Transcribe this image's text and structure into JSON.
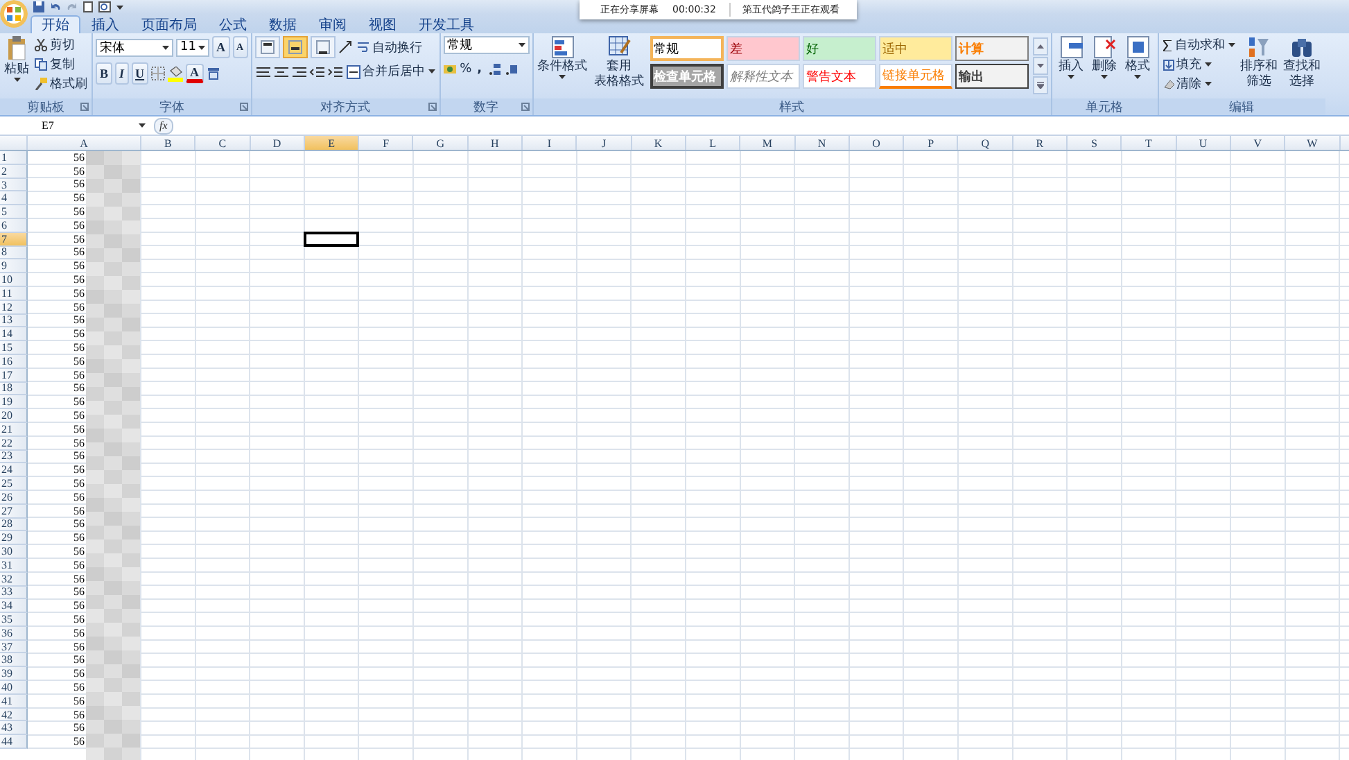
{
  "share_banner": {
    "status": "正在分享屏幕",
    "time": "00:00:32",
    "viewer": "第五代鸽子王正在观看"
  },
  "tabs": [
    {
      "label": "开始",
      "selected": true
    },
    {
      "label": "插入",
      "selected": false
    },
    {
      "label": "页面布局",
      "selected": false
    },
    {
      "label": "公式",
      "selected": false
    },
    {
      "label": "数据",
      "selected": false
    },
    {
      "label": "审阅",
      "selected": false
    },
    {
      "label": "视图",
      "selected": false
    },
    {
      "label": "开发工具",
      "selected": false
    }
  ],
  "ribbon": {
    "clipboard": {
      "label": "剪贴板",
      "paste": "粘贴",
      "items": [
        "剪切",
        "复制",
        "格式刷"
      ]
    },
    "font": {
      "label": "字体",
      "font_name": "宋体",
      "font_size": "11",
      "grow": "A",
      "shrink": "A",
      "bold": "B",
      "italic": "I",
      "underline": "U",
      "font_color": "A"
    },
    "alignment": {
      "label": "对齐方式",
      "vertical": [
        {
          "selected": false
        },
        {
          "selected": true
        },
        {
          "selected": false
        }
      ],
      "wrap": "自动换行",
      "merge": "合并后居中"
    },
    "number": {
      "label": "数字",
      "format": "常规",
      "percent": "%",
      "comma": ","
    },
    "styles": {
      "label": "样式",
      "conditional": "条件格式",
      "table": [
        "套用",
        "表格格式"
      ],
      "cell_styles": [
        {
          "name": "常规",
          "kind": "normal",
          "selected": true
        },
        {
          "name": "差",
          "kind": "bad",
          "selected": false
        },
        {
          "name": "好",
          "kind": "good",
          "selected": false
        },
        {
          "name": "适中",
          "kind": "neutral",
          "selected": false
        },
        {
          "name": "计算",
          "kind": "calc",
          "selected": false
        },
        {
          "name": "检查单元格",
          "kind": "check",
          "selected": false
        },
        {
          "name": "解释性文本",
          "kind": "explanatory",
          "selected": false
        },
        {
          "name": "警告文本",
          "kind": "warning",
          "selected": false
        },
        {
          "name": "链接单元格",
          "kind": "linked",
          "selected": false
        },
        {
          "name": "输出",
          "kind": "output",
          "selected": false
        }
      ]
    },
    "cells": {
      "label": "单元格",
      "buttons": [
        {
          "label": "插入",
          "kind": "insert"
        },
        {
          "label": "删除",
          "kind": "delete"
        },
        {
          "label": "格式",
          "kind": "format"
        }
      ]
    },
    "editing": {
      "label": "编辑",
      "autosum": "自动求和",
      "fill": "填充",
      "clear": "清除",
      "sort": [
        "排序和",
        "筛选"
      ],
      "find": [
        "查找和",
        "选择"
      ]
    }
  },
  "formula_bar": {
    "name_box": "E7",
    "fx": "fx"
  },
  "sheet": {
    "columns": [
      {
        "label": "A",
        "selected": false
      },
      {
        "label": "B",
        "selected": false
      },
      {
        "label": "C",
        "selected": false
      },
      {
        "label": "D",
        "selected": false
      },
      {
        "label": "E",
        "selected": true
      },
      {
        "label": "F",
        "selected": false
      },
      {
        "label": "G",
        "selected": false
      },
      {
        "label": "H",
        "selected": false
      },
      {
        "label": "I",
        "selected": false
      },
      {
        "label": "J",
        "selected": false
      },
      {
        "label": "K",
        "selected": false
      },
      {
        "label": "L",
        "selected": false
      },
      {
        "label": "M",
        "selected": false
      },
      {
        "label": "N",
        "selected": false
      },
      {
        "label": "O",
        "selected": false
      },
      {
        "label": "P",
        "selected": false
      },
      {
        "label": "Q",
        "selected": false
      },
      {
        "label": "R",
        "selected": false
      },
      {
        "label": "S",
        "selected": false
      },
      {
        "label": "T",
        "selected": false
      },
      {
        "label": "U",
        "selected": false
      },
      {
        "label": "V",
        "selected": false
      },
      {
        "label": "W",
        "selected": false
      }
    ],
    "rows": [
      {
        "label": "1",
        "selected": false,
        "a": "56"
      },
      {
        "label": "2",
        "selected": false,
        "a": "56"
      },
      {
        "label": "3",
        "selected": false,
        "a": "56"
      },
      {
        "label": "4",
        "selected": false,
        "a": "56"
      },
      {
        "label": "5",
        "selected": false,
        "a": "56"
      },
      {
        "label": "6",
        "selected": false,
        "a": "56"
      },
      {
        "label": "7",
        "selected": true,
        "a": "56"
      },
      {
        "label": "8",
        "selected": false,
        "a": "56"
      },
      {
        "label": "9",
        "selected": false,
        "a": "56"
      },
      {
        "label": "10",
        "selected": false,
        "a": "56"
      },
      {
        "label": "11",
        "selected": false,
        "a": "56"
      },
      {
        "label": "12",
        "selected": false,
        "a": "56"
      },
      {
        "label": "13",
        "selected": false,
        "a": "56"
      },
      {
        "label": "14",
        "selected": false,
        "a": "56"
      },
      {
        "label": "15",
        "selected": false,
        "a": "56"
      },
      {
        "label": "16",
        "selected": false,
        "a": "56"
      },
      {
        "label": "17",
        "selected": false,
        "a": "56"
      },
      {
        "label": "18",
        "selected": false,
        "a": "56"
      },
      {
        "label": "19",
        "selected": false,
        "a": "56"
      },
      {
        "label": "20",
        "selected": false,
        "a": "56"
      },
      {
        "label": "21",
        "selected": false,
        "a": "56"
      },
      {
        "label": "22",
        "selected": false,
        "a": "56"
      },
      {
        "label": "23",
        "selected": false,
        "a": "56"
      },
      {
        "label": "24",
        "selected": false,
        "a": "56"
      },
      {
        "label": "25",
        "selected": false,
        "a": "56"
      },
      {
        "label": "26",
        "selected": false,
        "a": "56"
      },
      {
        "label": "27",
        "selected": false,
        "a": "56"
      },
      {
        "label": "28",
        "selected": false,
        "a": "56"
      },
      {
        "label": "29",
        "selected": false,
        "a": "56"
      },
      {
        "label": "30",
        "selected": false,
        "a": "56"
      },
      {
        "label": "31",
        "selected": false,
        "a": "56"
      },
      {
        "label": "32",
        "selected": false,
        "a": "56"
      },
      {
        "label": "33",
        "selected": false,
        "a": "56"
      },
      {
        "label": "34",
        "selected": false,
        "a": "56"
      },
      {
        "label": "35",
        "selected": false,
        "a": "56"
      },
      {
        "label": "36",
        "selected": false,
        "a": "56"
      },
      {
        "label": "37",
        "selected": false,
        "a": "56"
      },
      {
        "label": "38",
        "selected": false,
        "a": "56"
      },
      {
        "label": "39",
        "selected": false,
        "a": "56"
      },
      {
        "label": "40",
        "selected": false,
        "a": "56"
      },
      {
        "label": "41",
        "selected": false,
        "a": "56"
      },
      {
        "label": "42",
        "selected": false,
        "a": "56"
      },
      {
        "label": "43",
        "selected": false,
        "a": "56"
      },
      {
        "label": "44",
        "selected": false,
        "a": "56"
      }
    ]
  }
}
